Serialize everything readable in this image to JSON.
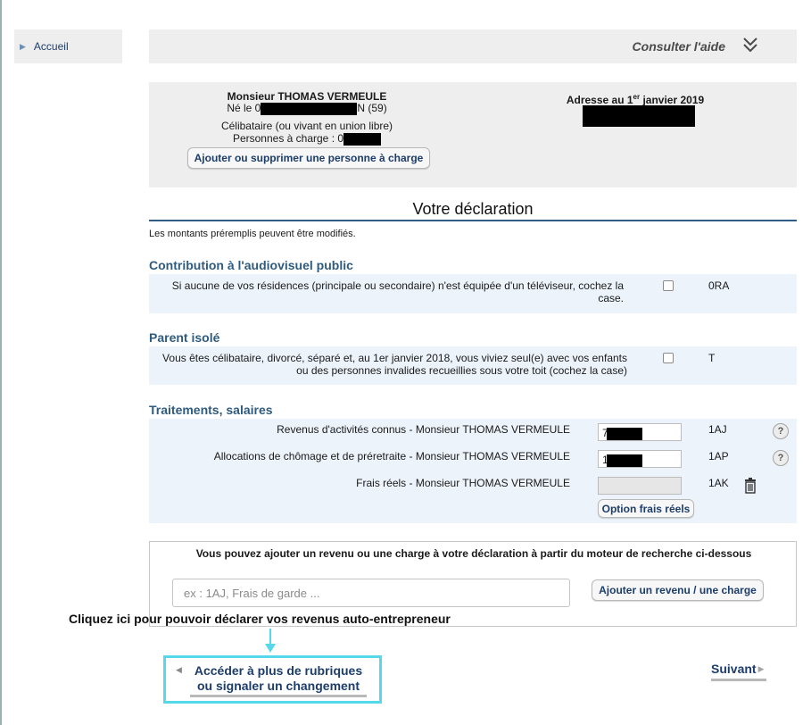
{
  "sidebar": {
    "items": [
      {
        "label": "Accueil"
      }
    ]
  },
  "header": {
    "help_link": "Consulter l'aide"
  },
  "identity": {
    "name": "Monsieur THOMAS VERMEULE",
    "born_prefix": "Né le 0",
    "born_suffix": "N (59)",
    "marital_status": "Célibataire (ou vivant en union libre)",
    "dependents_label": "Personnes à charge : 0",
    "add_person_button": "Ajouter ou supprimer une personne à charge",
    "address_title": "Adresse au 1",
    "address_title_sup": "er",
    "address_title_rest": " janvier 2019"
  },
  "declaration": {
    "title": "Votre déclaration",
    "prefill_note": "Les montants préremplis peuvent être modifiés."
  },
  "sections": {
    "audiovisuel": {
      "title": "Contribution à l'audiovisuel public",
      "question": "Si aucune de vos résidences (principale ou secondaire) n'est équipée d'un téléviseur, cochez la case.",
      "code": "0RA"
    },
    "parent_isole": {
      "title": "Parent isolé",
      "question": "Vous êtes célibataire, divorcé, séparé et, au 1er janvier 2018, vous viviez seul(e) avec vos enfants ou des personnes invalides recueillies sous votre toit (cochez la case)",
      "code": "T"
    },
    "salaires": {
      "title": "Traitements, salaires",
      "rows": [
        {
          "label": "Revenus d'activités connus - Monsieur THOMAS VERMEULE",
          "value_prefix": "7",
          "code": "1AJ",
          "help": "?"
        },
        {
          "label": "Allocations de chômage et de préretraite - Monsieur THOMAS VERMEULE",
          "value_prefix": "1",
          "code": "1AP",
          "help": "?"
        },
        {
          "label": "Frais réels - Monsieur THOMAS VERMEULE",
          "value_prefix": "",
          "code": "1AK"
        }
      ],
      "frais_button": "Option frais réels"
    }
  },
  "search": {
    "hint": "Vous pouvez ajouter un revenu ou une charge à votre déclaration à partir du moteur de recherche ci-dessous",
    "placeholder": "ex : 1AJ, Frais de garde ...",
    "add_button": "Ajouter un revenu / une charge"
  },
  "annotation": {
    "text": "Cliquez ici pour pouvoir déclarer vos revenus auto-entrepreneur"
  },
  "footer": {
    "more_line1": "Accéder à plus de rubriques",
    "more_line2": "ou signaler un changement",
    "next": "Suivant"
  },
  "colors": {
    "link": "#1d3d6b",
    "section_title": "#2f5b7e",
    "section_bg": "#ecf3fa",
    "panel_bg": "#eeeeee",
    "highlight": "#55d8ea"
  }
}
